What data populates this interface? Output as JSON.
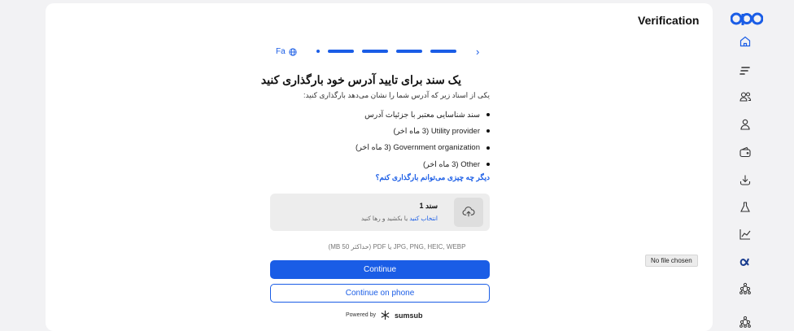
{
  "header": {
    "title": "Verification"
  },
  "language": {
    "label": "Fa",
    "icon": "globe-icon"
  },
  "progress": {
    "steps": 5,
    "next_icon": "chevron-right-icon"
  },
  "form": {
    "heading": "یک سند برای تایید آدرس خود بارگذاری کنید",
    "subtext": "یکی از اسناد زیر که آدرس شما را نشان می‌دهد بارگذاری کنید:",
    "documents": [
      "سند شناسایی معتبر با جزئیات آدرس",
      "Utility provider (3 ماه اخر)",
      "Government organization (3 ماه اخر)",
      "Other (3 ماه اخر)"
    ],
    "help_link": "دیگر چه چیزی می‌توانم بارگذاری کنم؟",
    "upload": {
      "title": "سند 1",
      "select_text": "انتخاب کنید",
      "drag_text": " یا بکشید و رها کنید",
      "icon": "cloud-upload-icon"
    },
    "formats": "JPG, PNG, HEIC, WEBP یا PDF (حداکثر 50 MB)",
    "continue_label": "Continue",
    "continue_phone_label": "Continue on phone"
  },
  "footer": {
    "powered_by": "Powered by",
    "brand": "sumsub"
  },
  "tooltip": {
    "text": "No file chosen"
  },
  "sidebar": {
    "items": [
      {
        "icon": "home-icon"
      },
      {
        "icon": "lines-logo-icon"
      },
      {
        "icon": "users-icon"
      },
      {
        "icon": "user-icon"
      },
      {
        "icon": "wallet-icon"
      },
      {
        "icon": "download-icon"
      },
      {
        "icon": "flask-icon"
      },
      {
        "icon": "chart-icon"
      },
      {
        "icon": "alpha-icon"
      },
      {
        "icon": "network-icon"
      },
      {
        "icon": "network-icon"
      }
    ],
    "accent": "#1a5de6"
  },
  "colors": {
    "accent": "#1a5de6",
    "upload_bg": "#ededed",
    "page_bg": "#f2f2f4"
  }
}
